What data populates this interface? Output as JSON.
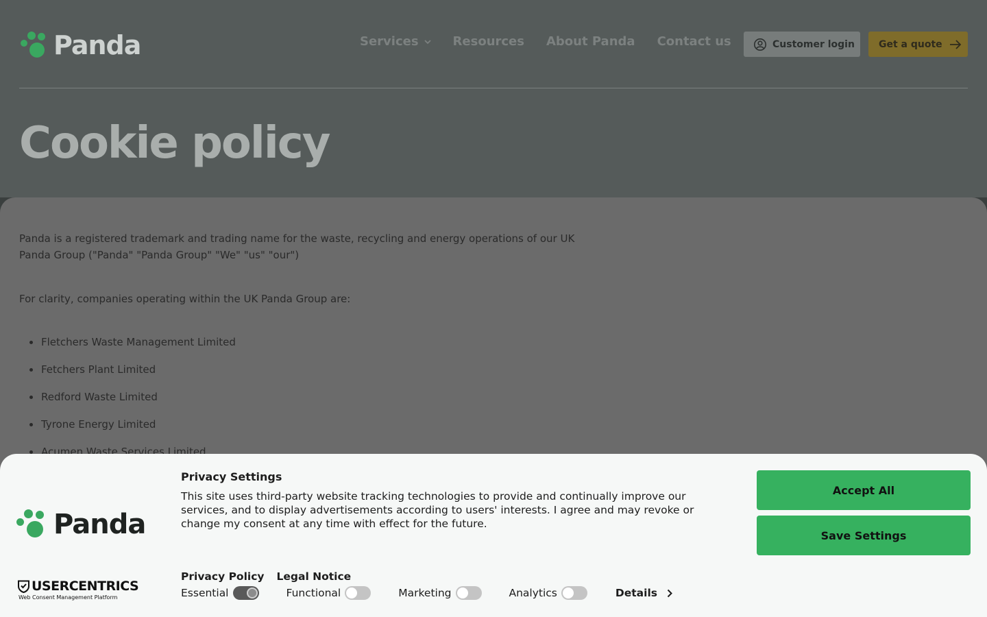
{
  "brand": {
    "name": "Panda",
    "accent": "#3aa860"
  },
  "nav": {
    "items": [
      {
        "label": "Services",
        "has_dropdown": true
      },
      {
        "label": "Resources",
        "has_dropdown": false
      },
      {
        "label": "About Panda",
        "has_dropdown": false
      },
      {
        "label": "Contact us",
        "has_dropdown": false
      }
    ],
    "login_label": "Customer login",
    "quote_label": "Get a quote"
  },
  "page": {
    "title": "Cookie policy",
    "intro_line1": "Panda is a registered trademark and trading name for the waste, recycling and energy operations of our UK",
    "intro_line2": "Panda Group (\"Panda\" \"Panda Group\" \"We\" \"us\" \"our\")",
    "clarity": "For clarity, companies operating within the UK Panda Group are:",
    "companies": [
      "Fletchers Waste Management Limited",
      "Fetchers Plant Limited",
      "Redford Waste Limited",
      "Tyrone Energy Limited",
      "Acumen Waste Services Limited"
    ]
  },
  "consent": {
    "title": "Privacy Settings",
    "text": "This site uses third-party website tracking technologies to provide and continually improve our services, and to display advertisements according to users' interests. I agree and may revoke or change my consent at any time with effect for the future.",
    "links": [
      "Privacy Policy",
      "Legal Notice"
    ],
    "toggles": [
      {
        "label": "Essential",
        "on": true
      },
      {
        "label": "Functional",
        "on": false
      },
      {
        "label": "Marketing",
        "on": false
      },
      {
        "label": "Analytics",
        "on": false
      }
    ],
    "details_label": "Details",
    "accept_label": "Accept All",
    "save_label": "Save Settings",
    "provider": "USERCENTRICS",
    "provider_sub": "Web Consent Management Platform",
    "button_color": "#36b15f"
  }
}
